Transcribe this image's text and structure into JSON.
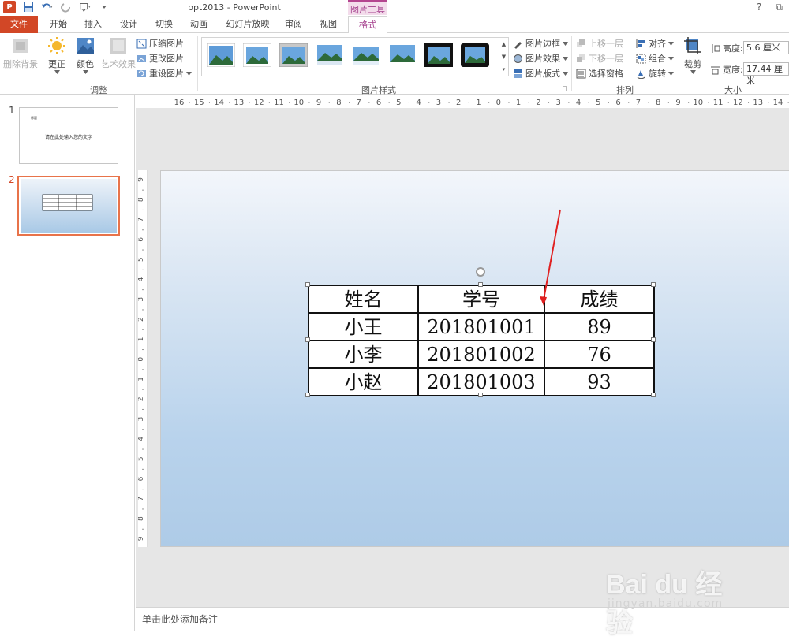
{
  "window": {
    "title": "ppt2013 - PowerPoint",
    "context_tab_group": "图片工具",
    "help": "?",
    "restore": "⧉",
    "logo": "P"
  },
  "tabs": [
    "文件",
    "开始",
    "插入",
    "设计",
    "切换",
    "动画",
    "幻灯片放映",
    "审阅",
    "视图",
    "格式"
  ],
  "ribbon": {
    "adjust": {
      "label": "调整",
      "remove_bg": "删除背景",
      "corrections": "更正",
      "color": "颜色",
      "artistic": "艺术效果",
      "compress": "压缩图片",
      "change": "更改图片",
      "reset": "重设图片"
    },
    "styles": {
      "label": "图片样式",
      "border": "图片边框",
      "effects": "图片效果",
      "layout": "图片版式"
    },
    "arrange": {
      "label": "排列",
      "bring_forward": "上移一层",
      "send_backward": "下移一层",
      "selection_pane": "选择窗格",
      "align": "对齐",
      "group": "组合",
      "rotate": "旋转"
    },
    "size": {
      "label": "大小",
      "crop": "裁剪",
      "height_label": "高度:",
      "height_value": "5.6 厘米",
      "width_label": "宽度:",
      "width_value": "17.44 厘米"
    }
  },
  "slides": [
    {
      "number": "1",
      "title": "标题",
      "text": "请在此处输入您的文字"
    },
    {
      "number": "2"
    }
  ],
  "table": {
    "header": [
      "姓名",
      "学号",
      "成绩"
    ],
    "rows": [
      [
        "小王",
        "201801001",
        "89"
      ],
      [
        "小李",
        "201801002",
        "76"
      ],
      [
        "小赵",
        "201801003",
        "93"
      ]
    ]
  },
  "notes": {
    "placeholder": "单击此处添加备注"
  },
  "hruler_labels": [
    "16",
    "15",
    "14",
    "13",
    "12",
    "11",
    "10",
    "9",
    "8",
    "7",
    "6",
    "5",
    "4",
    "3",
    "2",
    "1",
    "0",
    "1",
    "2",
    "3",
    "4",
    "5",
    "6",
    "7",
    "8",
    "9",
    "10",
    "11",
    "12",
    "13",
    "14"
  ],
  "vruler_labels": [
    "9",
    "8",
    "7",
    "6",
    "5",
    "4",
    "3",
    "2",
    "1",
    "0",
    "1",
    "2",
    "3",
    "4",
    "5",
    "6",
    "7",
    "8",
    "9"
  ],
  "watermark": {
    "logo": "Bai du 经验",
    "url": "jingyan.baidu.com"
  },
  "colors": {
    "accent": "#d24726",
    "context": "#a43e8c",
    "arrow": "#e02020"
  }
}
